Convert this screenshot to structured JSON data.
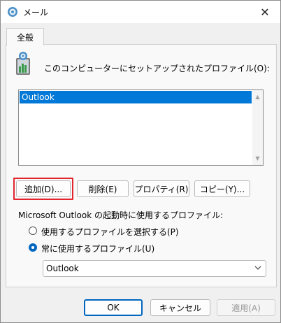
{
  "window": {
    "title": "メール",
    "close_glyph": "✕"
  },
  "tabs": [
    {
      "label": "全般"
    }
  ],
  "profiles": {
    "description": "このコンピューターにセットアップされたプロファイル(O):",
    "items": [
      "Outlook"
    ],
    "selected": "Outlook"
  },
  "buttons": {
    "add": "追加(D)...",
    "remove": "削除(E)",
    "properties": "プロパティ(R)",
    "copy": "コピー(Y)..."
  },
  "startup": {
    "label": "Microsoft Outlook の起動時に使用するプロファイル:",
    "option_prompt": "使用するプロファイルを選択する(P)",
    "option_always": "常に使用するプロファイル(U)",
    "selected_option": "always",
    "profile_select_value": "Outlook"
  },
  "footer": {
    "ok": "OK",
    "cancel": "キャンセル",
    "apply": "適用(A)"
  },
  "colors": {
    "selection": "#0078d7",
    "highlight_border": "#e3262e",
    "radio_checked": "#0067c0"
  },
  "icons": {
    "title": "mail-icon",
    "profile": "mail-profile-icon"
  }
}
